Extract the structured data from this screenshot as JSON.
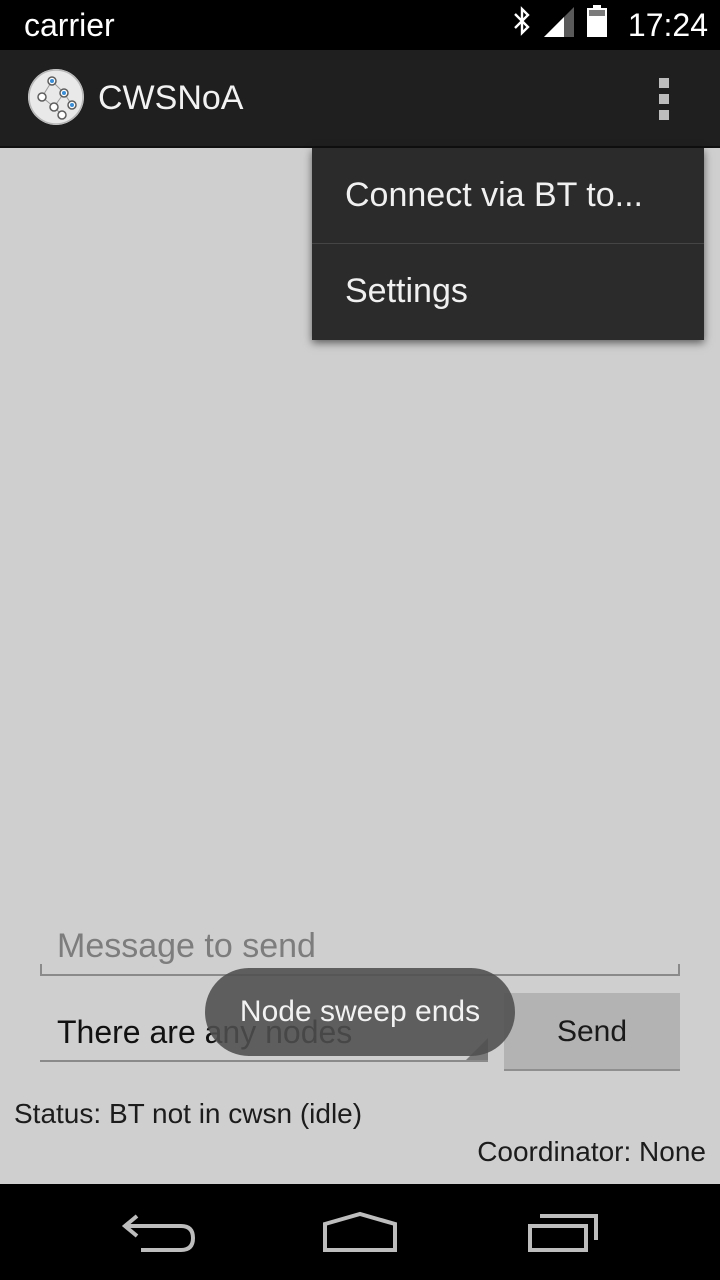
{
  "status_bar": {
    "carrier": "carrier",
    "time": "17:24",
    "icons": [
      "bluetooth-icon",
      "signal-icon",
      "battery-icon"
    ]
  },
  "action_bar": {
    "app_icon": "cwsnoa-logo-icon",
    "title": "CWSNoA",
    "overflow_icon": "overflow-menu-icon"
  },
  "menu": {
    "items": [
      {
        "label": "Connect via BT to..."
      },
      {
        "label": "Settings"
      }
    ]
  },
  "form": {
    "message_placeholder": "Message to send",
    "message_value": "",
    "nodes_spinner_value": "There are any nodes",
    "send_label": "Send"
  },
  "toast": {
    "text": "Node sweep ends"
  },
  "status": {
    "status_text": "Status: BT not in cwsn (idle)",
    "coordinator_text": "Coordinator: None"
  },
  "nav_bar": {
    "icons": [
      "back-icon",
      "home-icon",
      "recent-apps-icon"
    ]
  },
  "colors": {
    "background": "#cfcfcf",
    "action_bar": "#1f1f1f",
    "menu": "#2b2b2b",
    "send_button": "#b3b3b3",
    "toast": "#4e4e4e"
  }
}
